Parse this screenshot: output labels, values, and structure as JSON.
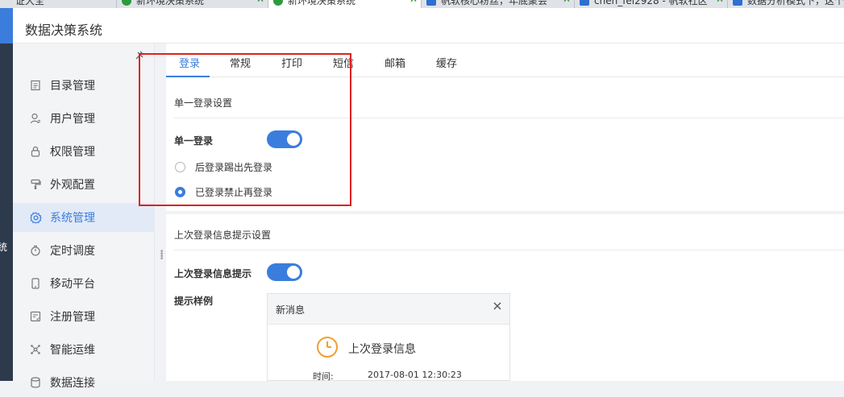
{
  "browser_tabs": [
    {
      "label": "证大全",
      "icon": "none"
    },
    {
      "label": "新环境决策系统",
      "icon": "green-circle-icon"
    },
    {
      "label": "新环境决策系统",
      "icon": "green-circle-icon"
    },
    {
      "label": "帆软核心粉丝，年底聚会",
      "icon": "blue-square-icon"
    },
    {
      "label": "chen_fei2928 - 帆软社区",
      "icon": "blue-square-icon"
    },
    {
      "label": "数据分析模式下，这个",
      "icon": "blue-square-icon"
    }
  ],
  "app": {
    "title": "数据决策系统",
    "rail_text": "统"
  },
  "sidebar": {
    "items": [
      {
        "label": "目录管理",
        "icon": "catalog-icon"
      },
      {
        "label": "用户管理",
        "icon": "user-icon"
      },
      {
        "label": "权限管理",
        "icon": "lock-icon"
      },
      {
        "label": "外观配置",
        "icon": "brush-icon"
      },
      {
        "label": "系统管理",
        "icon": "gear-icon",
        "active": true
      },
      {
        "label": "定时调度",
        "icon": "timer-icon"
      },
      {
        "label": "移动平台",
        "icon": "mobile-icon"
      },
      {
        "label": "注册管理",
        "icon": "register-icon"
      },
      {
        "label": "智能运维",
        "icon": "ops-icon"
      },
      {
        "label": "数据连接",
        "icon": "database-icon"
      }
    ]
  },
  "tabs": [
    {
      "label": "登录",
      "active": true
    },
    {
      "label": "常规"
    },
    {
      "label": "打印"
    },
    {
      "label": "短信"
    },
    {
      "label": "邮箱"
    },
    {
      "label": "缓存"
    }
  ],
  "single_login": {
    "section_title": "单一登录设置",
    "toggle_label": "单一登录",
    "toggle_on": true,
    "options": [
      {
        "label": "后登录踢出先登录",
        "selected": false
      },
      {
        "label": "已登录禁止再登录",
        "selected": true
      }
    ]
  },
  "last_login": {
    "section_title": "上次登录信息提示设置",
    "toggle_label": "上次登录信息提示",
    "toggle_on": true,
    "example_label": "提示样例",
    "preview": {
      "title": "新消息",
      "message": "上次登录信息",
      "time_label": "时间:",
      "time_value": "2017-08-01 12:30:23"
    }
  },
  "colors": {
    "accent": "#3b7ddd",
    "highlight": "#e02020",
    "clock": "#f0a030"
  }
}
